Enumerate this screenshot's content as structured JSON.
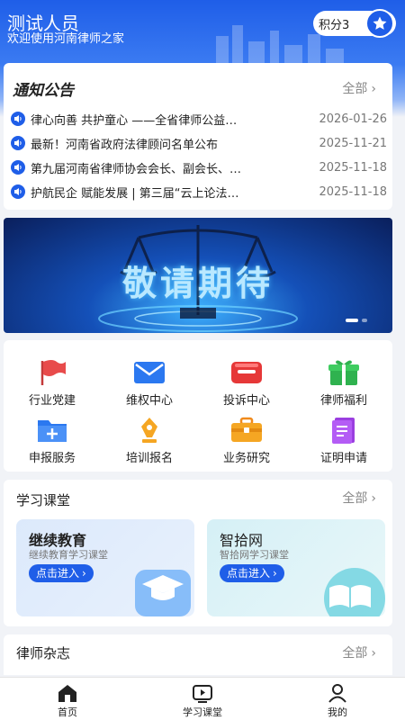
{
  "header": {
    "user_name": "测试人员",
    "welcome": "欢迎使用河南律师之家",
    "points_label": "积分3",
    "star_icon": "star-icon",
    "bg_color": "#1f5ee8"
  },
  "notice": {
    "title": "通知公告",
    "more_label": "全部",
    "items": [
      {
        "text": "律心向善 共护童心 ——全省律师公益…",
        "date": "2026-01-26"
      },
      {
        "text": "最新！河南省政府法律顾问名单公布",
        "date": "2025-11-21"
      },
      {
        "text": "第九届河南省律师协会会长、副会长、…",
        "date": "2025-11-18"
      },
      {
        "text": "护航民企 赋能发展 | 第三届“云上论法…",
        "date": "2025-11-18"
      }
    ]
  },
  "banner": {
    "text": "敬请期待",
    "dots": 2,
    "active_dot": 0
  },
  "grid": {
    "items": [
      {
        "label": "行业党建",
        "icon": "red-flag-icon"
      },
      {
        "label": "维权中心",
        "icon": "envelope-icon"
      },
      {
        "label": "投诉中心",
        "icon": "complaint-box-icon"
      },
      {
        "label": "律师福利",
        "icon": "gift-icon"
      },
      {
        "label": "申报服务",
        "icon": "folder-plus-icon"
      },
      {
        "label": "培训报名",
        "icon": "pen-nib-icon"
      },
      {
        "label": "业务研究",
        "icon": "briefcase-icon"
      },
      {
        "label": "证明申请",
        "icon": "document-icon"
      }
    ]
  },
  "study": {
    "title": "学习课堂",
    "more_label": "全部",
    "courses": [
      {
        "title": "继续教育",
        "subtitle": "继续教育学习课堂",
        "button": "点击进入",
        "icon": "graduation-cap-icon"
      },
      {
        "title": "智拾网",
        "subtitle": "智拾网学习课堂",
        "button": "点击进入",
        "icon": "open-book-icon"
      }
    ]
  },
  "magazine": {
    "title": "律师杂志",
    "more_label": "全部"
  },
  "bottom_nav": {
    "items": [
      {
        "label": "首页",
        "icon": "home-icon"
      },
      {
        "label": "学习课堂",
        "icon": "video-play-icon"
      },
      {
        "label": "我的",
        "icon": "user-icon"
      }
    ]
  }
}
